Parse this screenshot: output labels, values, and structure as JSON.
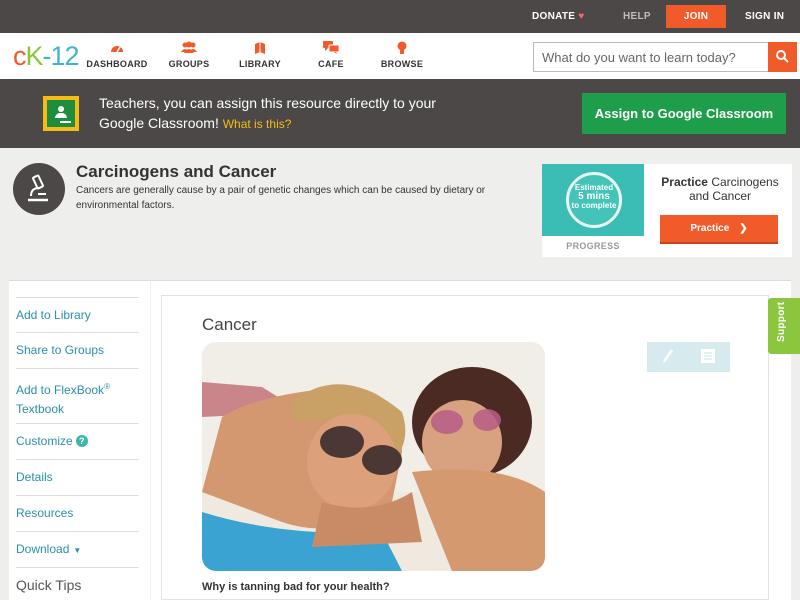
{
  "topbar": {
    "donate": "DONATE",
    "help": "HELP",
    "join": "JOIN",
    "signin": "SIGN IN"
  },
  "logo": {
    "part1": "c",
    "part2": "K",
    "part3": "-12"
  },
  "nav": {
    "dashboard": "DASHBOARD",
    "groups": "GROUPS",
    "library": "LIBRARY",
    "cafe": "CAFE",
    "browse": "BROWSE"
  },
  "search": {
    "placeholder": "What do you want to learn today?"
  },
  "teacher_banner": {
    "line": "Teachers, you can assign this resource directly to your Google Classroom!",
    "what_link": "What is this?",
    "assign_button": "Assign to Google Classroom"
  },
  "concept": {
    "title": "Carcinogens and Cancer",
    "description": "Cancers are generally cause by a pair of genetic changes which can be caused by dietary or environmental factors."
  },
  "practice": {
    "estimate_line1": "Estimated",
    "estimate_big": "5 mins",
    "estimate_line3": "to complete",
    "progress_label": "PROGRESS",
    "title_bold": "Practice",
    "title_rest": "Carcinogens and Cancer",
    "button": "Practice"
  },
  "sidebar": {
    "add_to_library": "Add to Library",
    "share_to_groups": "Share to Groups",
    "add_to_flexbook": "Add to FlexBook",
    "flexbook_mark": "®",
    "textbook": "Textbook",
    "customize": "Customize",
    "help_mark": "?",
    "details": "Details",
    "resources": "Resources",
    "download": "Download",
    "quick_tips": "Quick Tips"
  },
  "content": {
    "title": "Cancer",
    "question": "Why is tanning bad for your health?"
  },
  "support": "Support",
  "colors": {
    "dark_bar": "#4b4847",
    "orange": "#f15a29",
    "green_button": "#1e9e4a",
    "teal_link": "#2a8fa8",
    "support_green": "#8cc63f"
  }
}
